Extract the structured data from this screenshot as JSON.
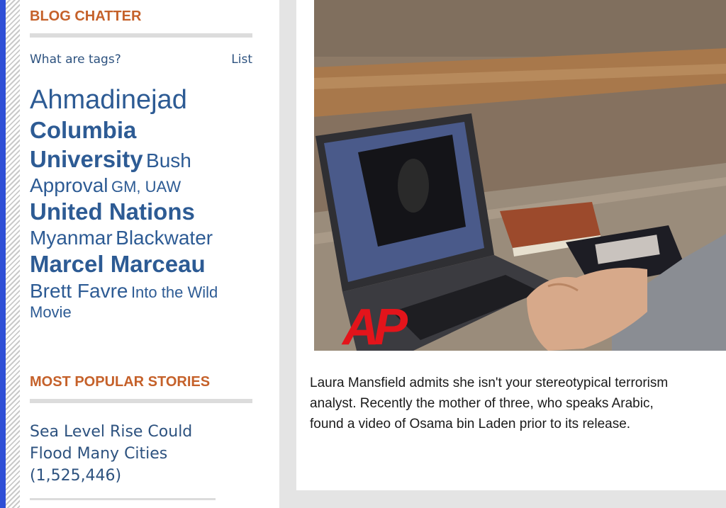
{
  "blog_chatter": {
    "heading": "BLOG CHATTER",
    "help_link": "What are tags?",
    "list_link": "List",
    "tags": [
      {
        "label": "Ahmadinejad",
        "size": 1
      },
      {
        "label": "Columbia",
        "size": 2
      },
      {
        "label": "University",
        "size": 2
      },
      {
        "label": "Bush",
        "size": 3
      },
      {
        "label": "Approval",
        "size": 3
      },
      {
        "label": "GM, UAW",
        "size": 4
      },
      {
        "label": "United Nations",
        "size": 2
      },
      {
        "label": "Myanmar",
        "size": 3
      },
      {
        "label": "Blackwater",
        "size": 3
      },
      {
        "label": "Marcel Marceau",
        "size": 2
      },
      {
        "label": "Brett Favre",
        "size": 3
      },
      {
        "label": "Into the Wild Movie",
        "size": 4
      }
    ]
  },
  "most_popular": {
    "heading": "MOST POPULAR STORIES",
    "items": [
      {
        "title": "Sea Level Rise Could Flood Many Cities",
        "count": "(1,525,446)"
      }
    ]
  },
  "main": {
    "photo_logo": "AP",
    "caption": "Laura Mansfield admits she isn't your stereotypical terrorism analyst. Recently the mother of three, who speaks Arabic, found a video of Osama bin Laden prior to its release.",
    "caption_lines": [
      "Laura Mansfield admits she isn't your stereotypical terrorism",
      "analyst. Recently the mother of three, who speaks Arabic,",
      "found a video of Osama bin Laden prior to its release."
    ]
  }
}
